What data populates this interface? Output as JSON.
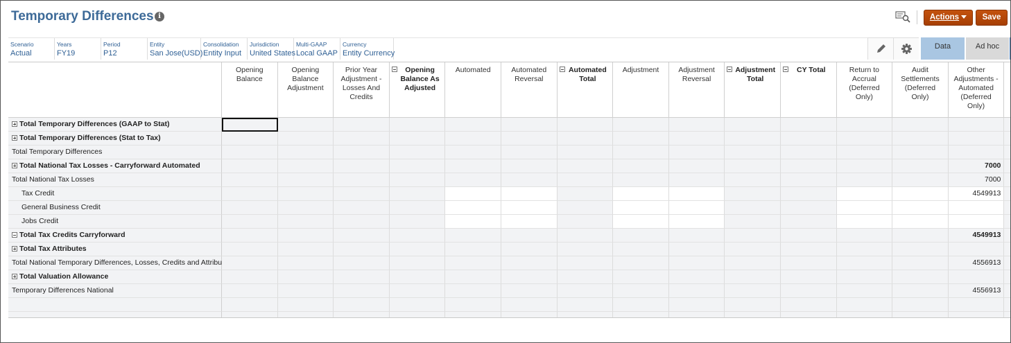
{
  "header": {
    "title": "Temporary Differences",
    "info_glyph": "i",
    "actions_label": "Actions",
    "save_label": "Save"
  },
  "pov": [
    {
      "label": "Scenario",
      "value": "Actual"
    },
    {
      "label": "Years",
      "value": "FY19"
    },
    {
      "label": "Period",
      "value": "P12"
    },
    {
      "label": "Entity",
      "value": "San Jose(USD)"
    },
    {
      "label": "Consolidation",
      "value": "Entity Input"
    },
    {
      "label": "Jurisdiction",
      "value": "United States"
    },
    {
      "label": "Multi-GAAP",
      "value": "Local GAAP"
    },
    {
      "label": "Currency",
      "value": "Entity Currency"
    }
  ],
  "tabs": {
    "data": "Data",
    "adhoc": "Ad hoc"
  },
  "columns": [
    {
      "label": "Opening Balance",
      "bold": false,
      "collapsible": false
    },
    {
      "label": "Opening Balance Adjustment",
      "bold": false,
      "collapsible": false
    },
    {
      "label": "Prior Year Adjustment - Losses And Credits",
      "bold": false,
      "collapsible": false
    },
    {
      "label": "Opening Balance As Adjusted",
      "bold": true,
      "collapsible": true
    },
    {
      "label": "Automated",
      "bold": false,
      "collapsible": false
    },
    {
      "label": "Automated Reversal",
      "bold": false,
      "collapsible": false
    },
    {
      "label": "Automated Total",
      "bold": true,
      "collapsible": true
    },
    {
      "label": "Adjustment",
      "bold": false,
      "collapsible": false
    },
    {
      "label": "Adjustment Reversal",
      "bold": false,
      "collapsible": false
    },
    {
      "label": "Adjustment Total",
      "bold": true,
      "collapsible": true
    },
    {
      "label": "CY Total",
      "bold": true,
      "collapsible": true
    },
    {
      "label": "Return to Accrual (Deferred Only)",
      "bold": false,
      "collapsible": false
    },
    {
      "label": "Audit Settlements (Deferred Only)",
      "bold": false,
      "collapsible": false
    },
    {
      "label": "Other Adjustments - Automated (Deferred Only)",
      "bold": false,
      "collapsible": false
    }
  ],
  "rows": [
    {
      "label": "Total Temporary Differences (GAAP to Stat)",
      "bold": true,
      "expander": "plus",
      "indent": false,
      "editable": false,
      "value": ""
    },
    {
      "label": "Total Temporary Differences (Stat to Tax)",
      "bold": true,
      "expander": "plus",
      "indent": false,
      "editable": false,
      "value": ""
    },
    {
      "label": "Total Temporary Differences",
      "bold": false,
      "expander": "",
      "indent": false,
      "editable": false,
      "value": ""
    },
    {
      "label": "Total National Tax Losses - Carryforward Automated",
      "bold": true,
      "expander": "plus",
      "indent": false,
      "editable": false,
      "value": "7000"
    },
    {
      "label": "Total National Tax Losses",
      "bold": false,
      "expander": "",
      "indent": false,
      "editable": false,
      "value": "7000"
    },
    {
      "label": "Tax Credit",
      "bold": false,
      "expander": "",
      "indent": true,
      "editable": true,
      "value": "4549913"
    },
    {
      "label": "General Business Credit",
      "bold": false,
      "expander": "",
      "indent": true,
      "editable": true,
      "value": ""
    },
    {
      "label": "Jobs Credit",
      "bold": false,
      "expander": "",
      "indent": true,
      "editable": true,
      "value": ""
    },
    {
      "label": "Total Tax Credits Carryforward",
      "bold": true,
      "expander": "minus",
      "indent": false,
      "editable": false,
      "value": "4549913"
    },
    {
      "label": "Total Tax Attributes",
      "bold": true,
      "expander": "plus",
      "indent": false,
      "editable": false,
      "value": ""
    },
    {
      "label": "Total National Temporary Differences, Losses, Credits and Attributes",
      "bold": false,
      "expander": "",
      "indent": false,
      "editable": false,
      "value": "4556913"
    },
    {
      "label": "Total Valuation Allowance",
      "bold": true,
      "expander": "plus",
      "indent": false,
      "editable": false,
      "value": ""
    },
    {
      "label": "Temporary Differences National",
      "bold": false,
      "expander": "",
      "indent": false,
      "editable": false,
      "value": "4556913"
    },
    {
      "label": "",
      "bold": false,
      "expander": "",
      "indent": false,
      "editable": false,
      "value": ""
    },
    {
      "label": "",
      "bold": false,
      "expander": "",
      "indent": false,
      "editable": false,
      "value": ""
    }
  ]
}
